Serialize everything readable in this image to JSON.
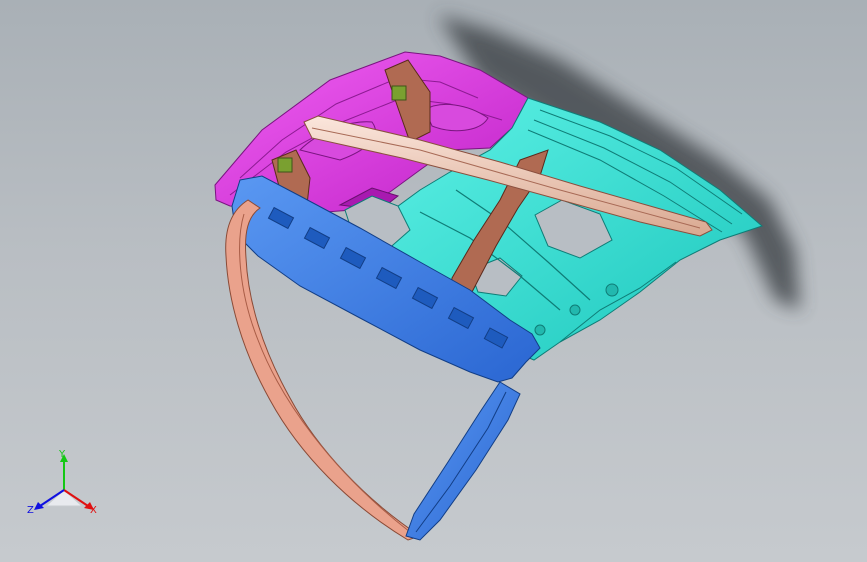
{
  "viewport": {
    "background_top": "#a9b0b6",
    "background_bottom": "#c6cace"
  },
  "model": {
    "parts": [
      {
        "name": "hood-outer-rear-panel",
        "color": "#e040e6"
      },
      {
        "name": "hood-inner-panel",
        "color": "#2fe6d8"
      },
      {
        "name": "front-reinforcement-beam",
        "color": "#3d7de8"
      },
      {
        "name": "hinge-brackets",
        "color": "#b06a52"
      },
      {
        "name": "longitudinal-strut",
        "color": "#f1c8b4"
      },
      {
        "name": "curved-side-arm",
        "color": "#eaa28c"
      },
      {
        "name": "blue-side-arm",
        "color": "#2f7fe0"
      }
    ]
  },
  "triad": {
    "x_label": "X",
    "y_label": "Y",
    "z_label": "Z",
    "x_color": "#e01010",
    "y_color": "#14c814",
    "z_color": "#1010e0"
  }
}
